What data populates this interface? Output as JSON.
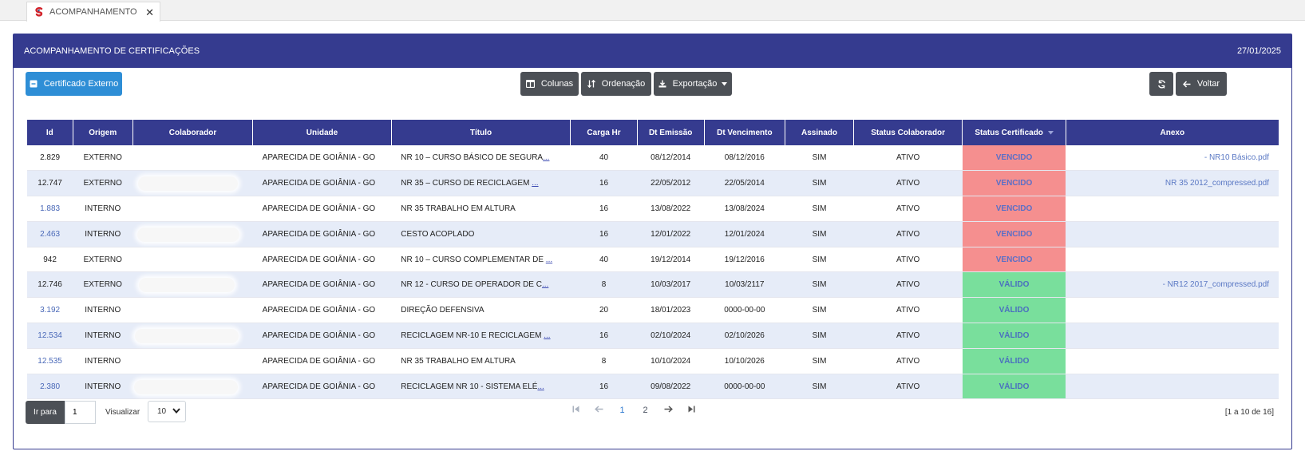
{
  "tab": {
    "title": "ACOMPANHAMENTO",
    "close": "✕"
  },
  "header": {
    "title": "ACOMPANHAMENTO DE CERTIFICAÇÕES",
    "date": "27/01/2025"
  },
  "toolbar": {
    "external_cert": "Certificado Externo",
    "columns": "Colunas",
    "ordering": "Ordenação",
    "export": "Exportação",
    "back": "Voltar"
  },
  "columns": [
    "Id",
    "Origem",
    "Colaborador",
    "Unidade",
    "Título",
    "Carga Hr",
    "Dt Emissão",
    "Dt Vencimento",
    "Assinado",
    "Status Colaborador",
    "Status Certificado",
    "Anexo"
  ],
  "rows": [
    {
      "id": "2.829",
      "origem": "EXTERNO",
      "unidade": "APARECIDA DE GOIÂNIA - GO",
      "titulo": "NR 10 – CURSO BÁSICO DE SEGURA",
      "ellipsis": "...",
      "carga": "40",
      "emissao": "08/12/2014",
      "vencimento": "08/12/2016",
      "assinado": "SIM",
      "status_colab": "ATIVO",
      "status_cert": "VENCIDO",
      "anexo": "- NR10 Básico.pdf"
    },
    {
      "id": "12.747",
      "origem": "EXTERNO",
      "unidade": "APARECIDA DE GOIÂNIA - GO",
      "titulo": "NR 35 – CURSO DE RECICLAGEM ",
      "ellipsis": "...",
      "carga": "16",
      "emissao": "22/05/2012",
      "vencimento": "22/05/2014",
      "assinado": "SIM",
      "status_colab": "ATIVO",
      "status_cert": "VENCIDO",
      "anexo": "NR 35 2012_compressed.pdf"
    },
    {
      "id": "1.883",
      "origem": "INTERNO",
      "unidade": "APARECIDA DE GOIÂNIA - GO",
      "titulo": "NR 35 TRABALHO EM ALTURA",
      "ellipsis": "",
      "carga": "16",
      "emissao": "13/08/2022",
      "vencimento": "13/08/2024",
      "assinado": "SIM",
      "status_colab": "ATIVO",
      "status_cert": "VENCIDO",
      "anexo": ""
    },
    {
      "id": "2.463",
      "origem": "INTERNO",
      "unidade": "APARECIDA DE GOIÂNIA - GO",
      "titulo": "CESTO ACOPLADO",
      "ellipsis": "",
      "carga": "16",
      "emissao": "12/01/2022",
      "vencimento": "12/01/2024",
      "assinado": "SIM",
      "status_colab": "ATIVO",
      "status_cert": "VENCIDO",
      "anexo": ""
    },
    {
      "id": "942",
      "origem": "EXTERNO",
      "unidade": "APARECIDA DE GOIÂNIA - GO",
      "titulo": "NR 10 – CURSO COMPLEMENTAR DE ",
      "ellipsis": "...",
      "carga": "40",
      "emissao": "19/12/2014",
      "vencimento": "19/12/2016",
      "assinado": "SIM",
      "status_colab": "ATIVO",
      "status_cert": "VENCIDO",
      "anexo": ""
    },
    {
      "id": "12.746",
      "origem": "EXTERNO",
      "unidade": "APARECIDA DE GOIÂNIA - GO",
      "titulo": "NR 12 - CURSO DE OPERADOR DE C",
      "ellipsis": "...",
      "carga": "8",
      "emissao": "10/03/2017",
      "vencimento": "10/03/2117",
      "assinado": "SIM",
      "status_colab": "ATIVO",
      "status_cert": "VÁLIDO",
      "anexo": "- NR12 2017_compressed.pdf"
    },
    {
      "id": "3.192",
      "origem": "INTERNO",
      "unidade": "APARECIDA DE GOIÂNIA - GO",
      "titulo": "DIREÇÃO DEFENSIVA",
      "ellipsis": "",
      "carga": "20",
      "emissao": "18/01/2023",
      "vencimento": "0000-00-00",
      "assinado": "SIM",
      "status_colab": "ATIVO",
      "status_cert": "VÁLIDO",
      "anexo": ""
    },
    {
      "id": "12.534",
      "origem": "INTERNO",
      "unidade": "APARECIDA DE GOIÂNIA - GO",
      "titulo": "RECICLAGEM NR-10 E RECICLAGEM ",
      "ellipsis": "...",
      "carga": "16",
      "emissao": "02/10/2024",
      "vencimento": "02/10/2026",
      "assinado": "SIM",
      "status_colab": "ATIVO",
      "status_cert": "VÁLIDO",
      "anexo": ""
    },
    {
      "id": "12.535",
      "origem": "INTERNO",
      "unidade": "APARECIDA DE GOIÂNIA - GO",
      "titulo": "NR 35 TRABALHO EM ALTURA",
      "ellipsis": "",
      "carga": "8",
      "emissao": "10/10/2024",
      "vencimento": "10/10/2026",
      "assinado": "SIM",
      "status_colab": "ATIVO",
      "status_cert": "VÁLIDO",
      "anexo": ""
    },
    {
      "id": "2.380",
      "origem": "INTERNO",
      "unidade": "APARECIDA DE GOIÂNIA - GO",
      "titulo": "RECICLAGEM NR 10 - SISTEMA ELÉ",
      "ellipsis": "...",
      "carga": "16",
      "emissao": "09/08/2022",
      "vencimento": "0000-00-00",
      "assinado": "SIM",
      "status_colab": "ATIVO",
      "status_cert": "VÁLIDO",
      "anexo": ""
    }
  ],
  "footer": {
    "goto_label": "Ir para",
    "page_value": "1",
    "show_label": "Visualizar",
    "page_size": "10",
    "pages": [
      "1",
      "2"
    ],
    "count": "[1 a 10 de 16]"
  },
  "colors": {
    "header": "#353b8f",
    "expired": "#f58f8f",
    "valid": "#79df9c",
    "primary_button": "#2e8ed6",
    "dark_button": "#4c5056"
  }
}
